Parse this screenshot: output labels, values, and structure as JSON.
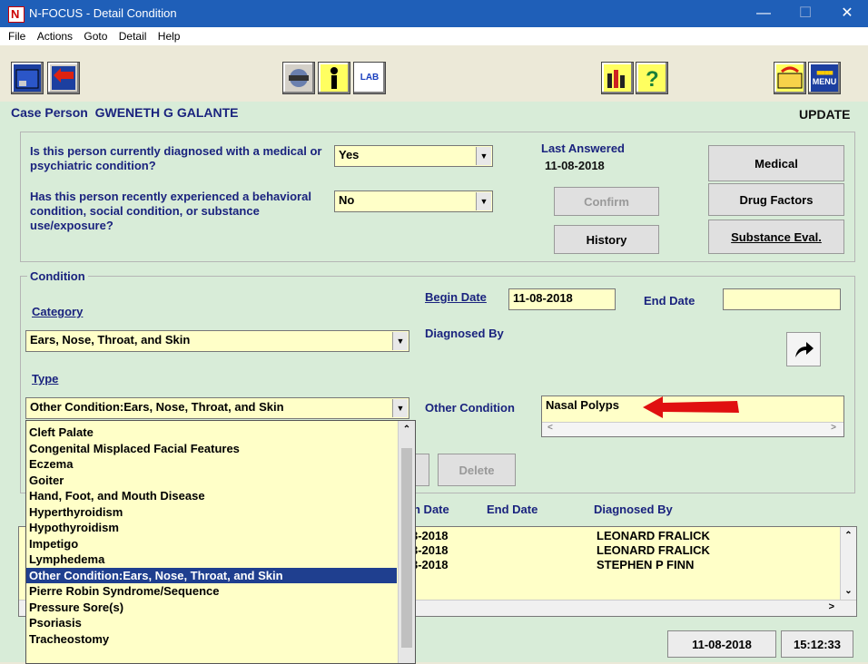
{
  "window": {
    "title": "N-FOCUS - Detail Condition",
    "icon_letter": "N"
  },
  "menu": [
    "File",
    "Actions",
    "Goto",
    "Detail",
    "Help"
  ],
  "toolbar": {
    "lab_label": "LAB",
    "menu_label": "MENU"
  },
  "header": {
    "case_person_label": "Case Person",
    "case_person_name": "GWENETH G GALANTE",
    "mode": "UPDATE"
  },
  "questions": {
    "q1": "Is this person currently diagnosed with a medical or psychiatric condition?",
    "q1_answer": "Yes",
    "q2": "Has this person recently experienced a behavioral condition, social condition, or substance use/exposure?",
    "q2_answer": "No",
    "last_answered_label": "Last Answered",
    "last_answered_date": "11-08-2018",
    "confirm": "Confirm",
    "history": "History"
  },
  "side_buttons": {
    "medical": "Medical",
    "drug_factors": "Drug Factors",
    "substance_eval": "Substance Eval."
  },
  "condition": {
    "group_label": "Condition",
    "category_label": "Category",
    "category_value": "Ears, Nose, Throat, and Skin",
    "type_label": "Type",
    "type_value": "Other Condition:Ears, Nose, Throat, and Skin",
    "begin_date_label": "Begin Date",
    "begin_date": "11-08-2018",
    "end_date_label": "End Date",
    "end_date": "",
    "diagnosed_by_label": "Diagnosed By",
    "other_condition_label": "Other Condition",
    "other_condition_value": "Nasal Polyps",
    "delete": "Delete"
  },
  "type_options": [
    "Cleft Palate",
    "Congenital Misplaced Facial Features",
    "Eczema",
    "Goiter",
    "Hand, Foot, and Mouth Disease",
    "Hyperthyroidism",
    "Hypothyroidism",
    "Impetigo",
    "Lymphedema",
    "Other Condition:Ears, Nose, Throat, and Skin",
    "Pierre Robin Syndrome/Sequence",
    "Pressure Sore(s)",
    "Psoriasis",
    "Tracheostomy"
  ],
  "history_table": {
    "headers": [
      "n Date",
      "End Date",
      "Diagnosed By"
    ],
    "rows": [
      {
        "begin": "3-2018",
        "diagnosed_by": "LEONARD FRALICK"
      },
      {
        "begin": "3-2018",
        "diagnosed_by": "LEONARD FRALICK"
      },
      {
        "begin": "3-2018",
        "diagnosed_by": "STEPHEN P FINN"
      }
    ]
  },
  "statusbar": {
    "date": "11-08-2018",
    "time": "15:12:33"
  },
  "colors": {
    "titlebar": "#1f5fb8",
    "panel": "#d8ecd8",
    "field": "#ffffc8",
    "selection": "#1f3f8f",
    "arrow": "#e01010"
  }
}
